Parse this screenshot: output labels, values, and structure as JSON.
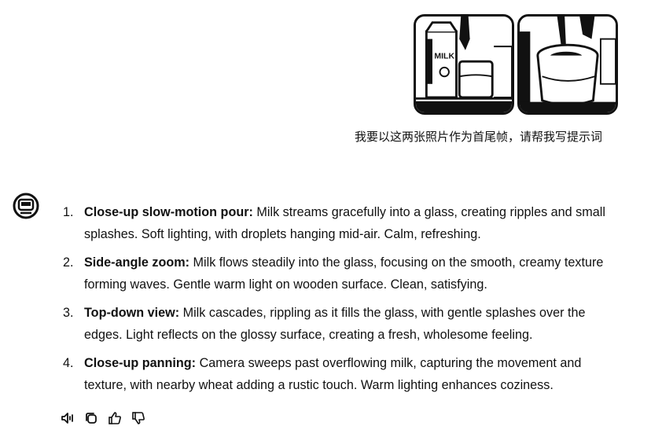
{
  "attachments": [
    {
      "icon": "milk-carton-glass-photo",
      "carton_text": "MILK"
    },
    {
      "icon": "milk-pouring-into-glass-photo"
    }
  ],
  "user_message": "我要以这两张照片作为首尾帧，请帮我写提示词",
  "assistant": {
    "avatar_icon": "assistant-bot-icon",
    "items": [
      {
        "num": "1.",
        "title": "Close-up slow-motion pour:",
        "text": " Milk streams gracefully into a glass, creating ripples and small splashes. Soft lighting, with droplets hanging mid-air. Calm, refreshing."
      },
      {
        "num": "2.",
        "title": "Side-angle zoom:",
        "text": " Milk flows steadily into the glass, focusing on the smooth, creamy texture forming waves. Gentle warm light on wooden surface. Clean, satisfying."
      },
      {
        "num": "3.",
        "title": "Top-down view:",
        "text": " Milk cascades, rippling as it fills the glass, with gentle splashes over the edges. Light reflects on the glossy surface, creating a fresh, wholesome feeling."
      },
      {
        "num": "4.",
        "title": "Close-up panning:",
        "text": " Camera sweeps past overflowing milk, capturing the movement and texture, with nearby wheat adding a rustic touch. Warm lighting enhances coziness."
      }
    ]
  },
  "actions": [
    "speaker-icon",
    "copy-icon",
    "thumbs-up-icon",
    "thumbs-down-icon"
  ]
}
